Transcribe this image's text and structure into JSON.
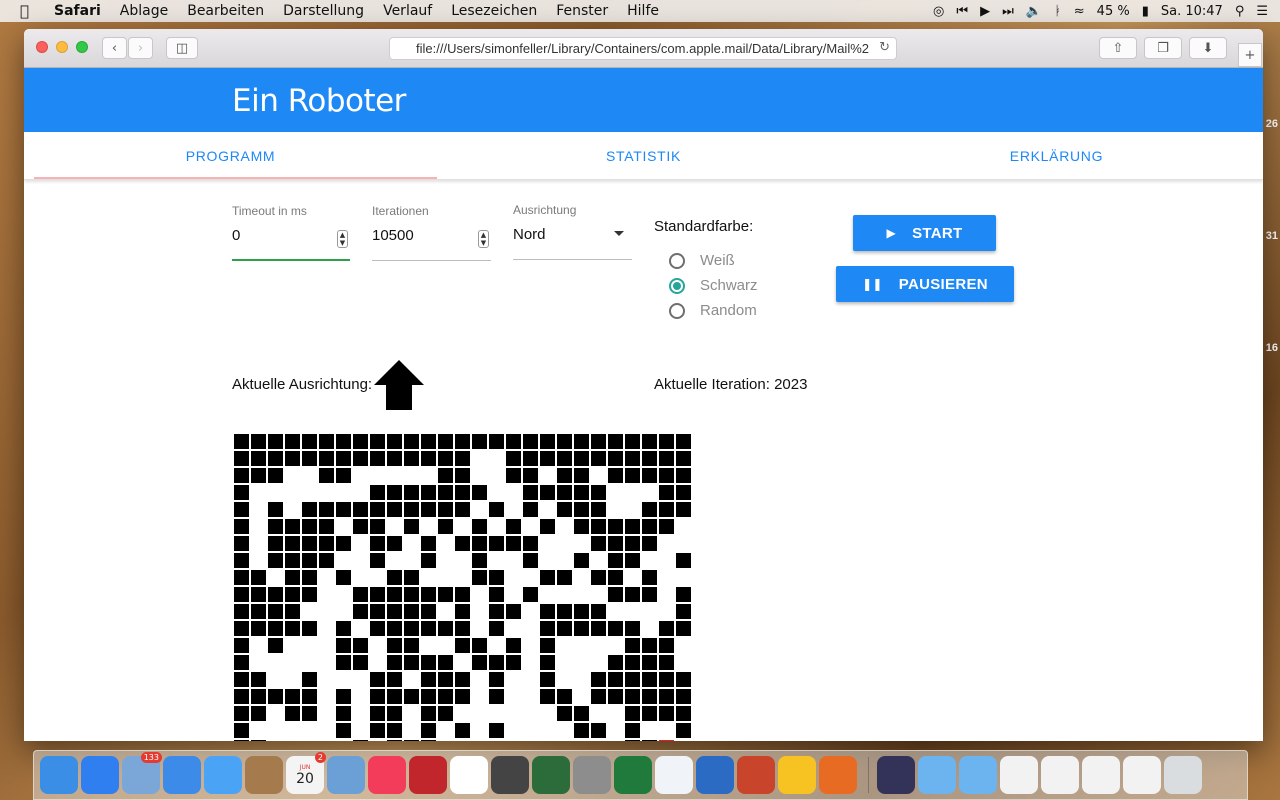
{
  "menubar": {
    "app": "Safari",
    "items": [
      "Ablage",
      "Bearbeiten",
      "Darstellung",
      "Verlauf",
      "Lesezeichen",
      "Fenster",
      "Hilfe"
    ],
    "battery": "45 %",
    "clock": "Sa. 10:47"
  },
  "browser": {
    "url": "file:///Users/simonfeller/Library/Containers/com.apple.mail/Data/Library/Mail%2"
  },
  "app": {
    "title": "Ein Roboter",
    "tabs": [
      {
        "label": "PROGRAMM",
        "active": true
      },
      {
        "label": "STATISTIK",
        "active": false
      },
      {
        "label": "ERKLÄRUNG",
        "active": false
      }
    ]
  },
  "form": {
    "timeout": {
      "label": "Timeout in ms",
      "value": "0"
    },
    "iterations": {
      "label": "Iterationen",
      "value": "10500"
    },
    "direction": {
      "label": "Ausrichtung",
      "value": "Nord"
    },
    "color": {
      "label": "Standardfarbe:",
      "options": [
        {
          "label": "Weiß",
          "checked": false
        },
        {
          "label": "Schwarz",
          "checked": true
        },
        {
          "label": "Random",
          "checked": false
        }
      ]
    }
  },
  "buttons": {
    "start": "START",
    "pause": "PAUSIEREN"
  },
  "status": {
    "direction_label": "Aktuelle Ausrichtung:",
    "iteration_label": "Aktuelle Iteration: 2023"
  },
  "grid": {
    "rows": [
      "###########################",
      "##############..###########",
      "###..##.....##..##.##.#####",
      "#.......#######..#####...##",
      "#.#.##########.#.#.###..###",
      "#.####.##.#.#.#.#.#.######.",
      "#.#####.##.#.#####...####..",
      "#.####..#..#..#..#..#.##..#",
      "##.##.#..##...##..##.##.#..",
      "#####..#######.#.#....###.#",
      "####...#####.#.##.####....#",
      "#####.#.######.#..######.##",
      "#.#...##.##..##.#.#....###.",
      "#.....##.####.###.#...####.",
      "##..#...##.###.#..#..######",
      "#####.#.######.#..##.######",
      "##.##.#.##.##......##..####",
      "#.....#.##.#.#.#....##.#..#",
      "##.....#.###...........##R."
    ]
  },
  "dock": {
    "apps": [
      "finder-icon",
      "appstore-icon",
      "mail-icon",
      "safari-icon",
      "messages-icon",
      "contacts-icon",
      "calendar-icon",
      "preview-icon",
      "itunes-icon",
      "photobooth-icon",
      "photos-icon",
      "imovie-icon",
      "timemachine-icon",
      "systemprefs-icon",
      "excel-icon",
      "notes-icon",
      "word-icon",
      "powerpoint-icon",
      "onenote-icon",
      "firefox-icon",
      "launchpad-icon"
    ],
    "mail_badge": "133",
    "calendar_badge": "2",
    "calendar_month": "JUN",
    "calendar_day": "20"
  }
}
